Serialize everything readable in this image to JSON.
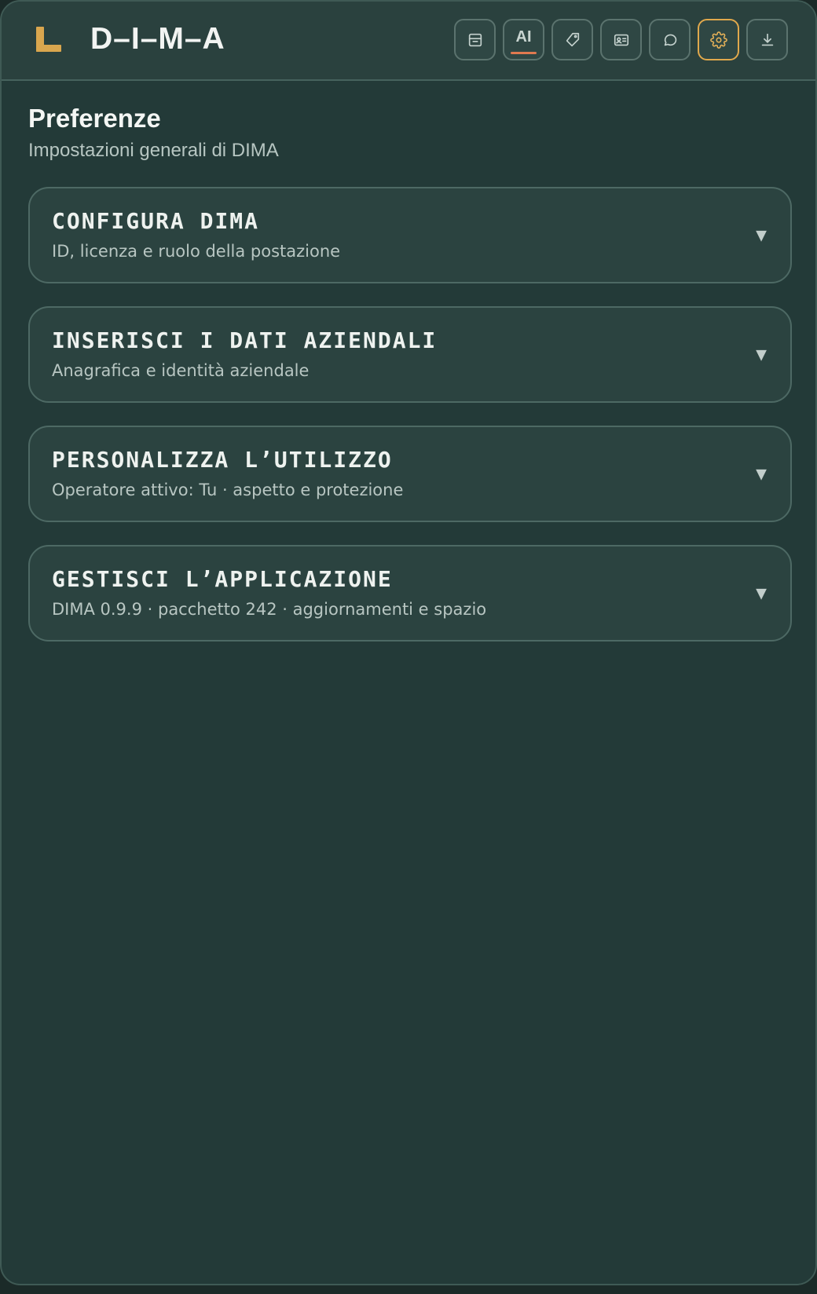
{
  "app": {
    "title": "D–I–M–A"
  },
  "toolbar": {
    "buttons": [
      {
        "icon": "archive-icon"
      },
      {
        "label": "AI",
        "icon": "ai-icon"
      },
      {
        "icon": "tag-icon"
      },
      {
        "icon": "id-card-icon"
      },
      {
        "icon": "chat-bubble-icon"
      },
      {
        "icon": "gear-icon",
        "active": true
      },
      {
        "icon": "download-icon"
      }
    ]
  },
  "page": {
    "title": "Preferenze",
    "subtitle": "Impostazioni generali di DIMA"
  },
  "sections": [
    {
      "title": "CONFIGURA DIMA",
      "subtitle": "ID, licenza e ruolo della postazione",
      "chevron": "▼"
    },
    {
      "title": "INSERISCI I DATI AZIENDALI",
      "subtitle": "Anagrafica e identità aziendale",
      "chevron": "▼"
    },
    {
      "title": "PERSONALIZZA L’UTILIZZO",
      "subtitle": "Operatore attivo: Tu · aspetto e protezione",
      "chevron": "▼"
    },
    {
      "title": "GESTISCI L’APPLICAZIONE",
      "subtitle": "DIMA 0.9.9 · pacchetto 242 · aggiornamenti e spazio",
      "chevron": "▼"
    }
  ],
  "colors": {
    "background": "#233a38",
    "header": "#2a413e",
    "accent": "#e0a84c",
    "ai_underline": "#e07950"
  }
}
